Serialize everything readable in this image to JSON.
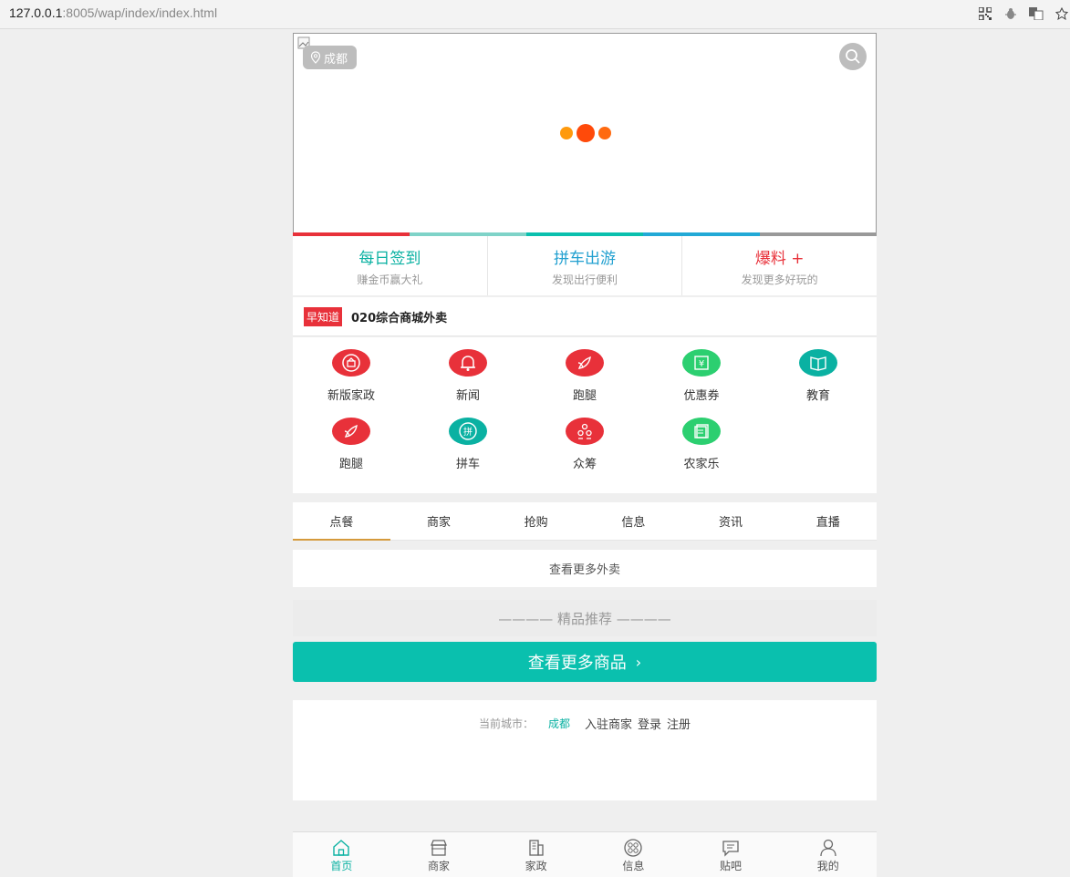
{
  "browser": {
    "url_host": "127.0.0.1",
    "url_rest": ":8005/wap/index/index.html"
  },
  "banner": {
    "city": "成都",
    "strip_colors": [
      "#e8313a",
      "#7fd3c8",
      "#0ac0ae",
      "#22a9d6",
      "#999999"
    ]
  },
  "quick_links": [
    {
      "title": "每日签到",
      "sub": "赚金币赢大礼",
      "color": "#0ab1a2"
    },
    {
      "title": "拼车出游",
      "sub": "发现出行便利",
      "color": "#22a0d0"
    },
    {
      "title": "爆料 +",
      "sub": "发现更多好玩的",
      "color": "#e8313a"
    }
  ],
  "news": {
    "tag": "早知道",
    "text": "020综合商城外卖"
  },
  "grid": [
    {
      "label": "新版家政",
      "color": "#e8313a",
      "icon": "housekeeping-icon"
    },
    {
      "label": "新闻",
      "color": "#e8313a",
      "icon": "bell-icon"
    },
    {
      "label": "跑腿",
      "color": "#e8313a",
      "icon": "leaf-icon"
    },
    {
      "label": "优惠券",
      "color": "#2ccf70",
      "icon": "coupon-icon"
    },
    {
      "label": "教育",
      "color": "#0ab1a2",
      "icon": "book-icon"
    },
    {
      "label": "跑腿",
      "color": "#e8313a",
      "icon": "leaf-icon"
    },
    {
      "label": "拼车",
      "color": "#0ab1a2",
      "icon": "carpool-icon"
    },
    {
      "label": "众筹",
      "color": "#e8313a",
      "icon": "crowdfund-icon"
    },
    {
      "label": "农家乐",
      "color": "#2ccf70",
      "icon": "farm-icon"
    }
  ],
  "tabs": [
    "点餐",
    "商家",
    "抢购",
    "信息",
    "资讯",
    "直播"
  ],
  "more_takeout": "查看更多外卖",
  "recommend": {
    "title": "———— 精品推荐 ————",
    "more_goods": "查看更多商品",
    "arrow": "›"
  },
  "footer": {
    "city_label": "当前城市：",
    "city": "成都",
    "links": [
      "入驻商家",
      "登录",
      "注册"
    ]
  },
  "bottom_nav": [
    {
      "label": "首页",
      "icon": "home-icon",
      "active": true
    },
    {
      "label": "商家",
      "icon": "shop-icon",
      "active": false
    },
    {
      "label": "家政",
      "icon": "building-icon",
      "active": false
    },
    {
      "label": "信息",
      "icon": "info-icon",
      "active": false
    },
    {
      "label": "贴吧",
      "icon": "chat-icon",
      "active": false
    },
    {
      "label": "我的",
      "icon": "user-icon",
      "active": false
    }
  ]
}
